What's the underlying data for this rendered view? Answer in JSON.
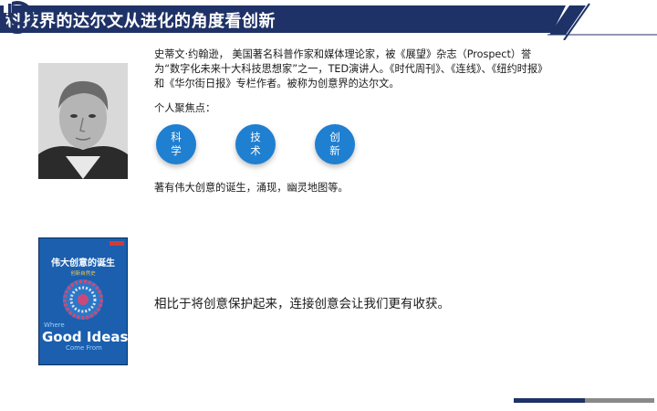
{
  "header": {
    "title": "科技界的达尔文从进化的角度看创新"
  },
  "person": {
    "bio": "史蒂文·约翰逊， 美国著名科普作家和媒体理论家，被《展望》杂志（Prospect）誉为“数字化未来十大科技思想家”之一，TED演讲人。《时代周刊》、《连线》、《纽约时报》和《华尔街日报》专栏作者。被称为创意界的达尔文。",
    "focus_label": "个人聚焦点：",
    "focus_items": [
      "科学",
      "技术",
      "创新"
    ],
    "works": "著有伟大创意的诞生，涌现，幽灵地图等。"
  },
  "book_cover": {
    "title_cn": "伟大创意的诞生",
    "subtitle_cn": "创新自然史",
    "title_en_1": "Where",
    "title_en_2": "Good Ideas",
    "title_en_3": "Come From"
  },
  "conclusion": "相比于将创意保护起来，连接创意会让我们更有收获。",
  "colors": {
    "header_navy": "#1f3267",
    "circle_blue": "#1f7fd0",
    "bar_gray": "#8a8a8a"
  }
}
